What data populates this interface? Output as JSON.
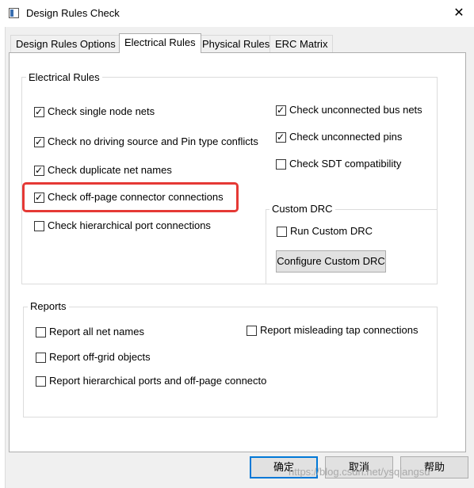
{
  "window": {
    "title": "Design Rules Check",
    "close_glyph": "✕",
    "icon": "dialog-icon"
  },
  "tabs": [
    {
      "label": "Design Rules Options",
      "active": false
    },
    {
      "label": "Electrical Rules",
      "active": true
    },
    {
      "label": "Physical Rules",
      "active": false
    },
    {
      "label": "ERC Matrix",
      "active": false
    }
  ],
  "electrical_rules": {
    "legend": "Electrical Rules",
    "left": [
      {
        "label": "Check single node nets",
        "checked": true
      },
      {
        "label": "Check no driving source and Pin type conflicts",
        "checked": true
      },
      {
        "label": "Check duplicate net names",
        "checked": true
      },
      {
        "label": "Check off-page connector connections",
        "checked": true
      },
      {
        "label": "Check hierarchical port connections",
        "checked": false
      }
    ],
    "right": [
      {
        "label": "Check unconnected bus nets",
        "checked": true
      },
      {
        "label": "Check unconnected pins",
        "checked": true
      },
      {
        "label": "Check SDT compatibility",
        "checked": false
      }
    ]
  },
  "custom_drc": {
    "legend": "Custom DRC",
    "run": {
      "label": "Run Custom DRC",
      "checked": false
    },
    "configure_button": "Configure Custom DRC"
  },
  "reports": {
    "legend": "Reports",
    "items": [
      {
        "label": "Report all net names",
        "checked": false
      },
      {
        "label": "Report misleading tap connections",
        "checked": false
      },
      {
        "label": "Report off-grid objects",
        "checked": false
      },
      {
        "label": "Report hierarchical ports and off-page connecto",
        "checked": false
      }
    ]
  },
  "buttons": {
    "ok": "确定",
    "cancel": "取消",
    "help": "帮助"
  },
  "watermark": "https://blog.csdn.net/ysqiangsu",
  "highlight_color": "#e53935"
}
